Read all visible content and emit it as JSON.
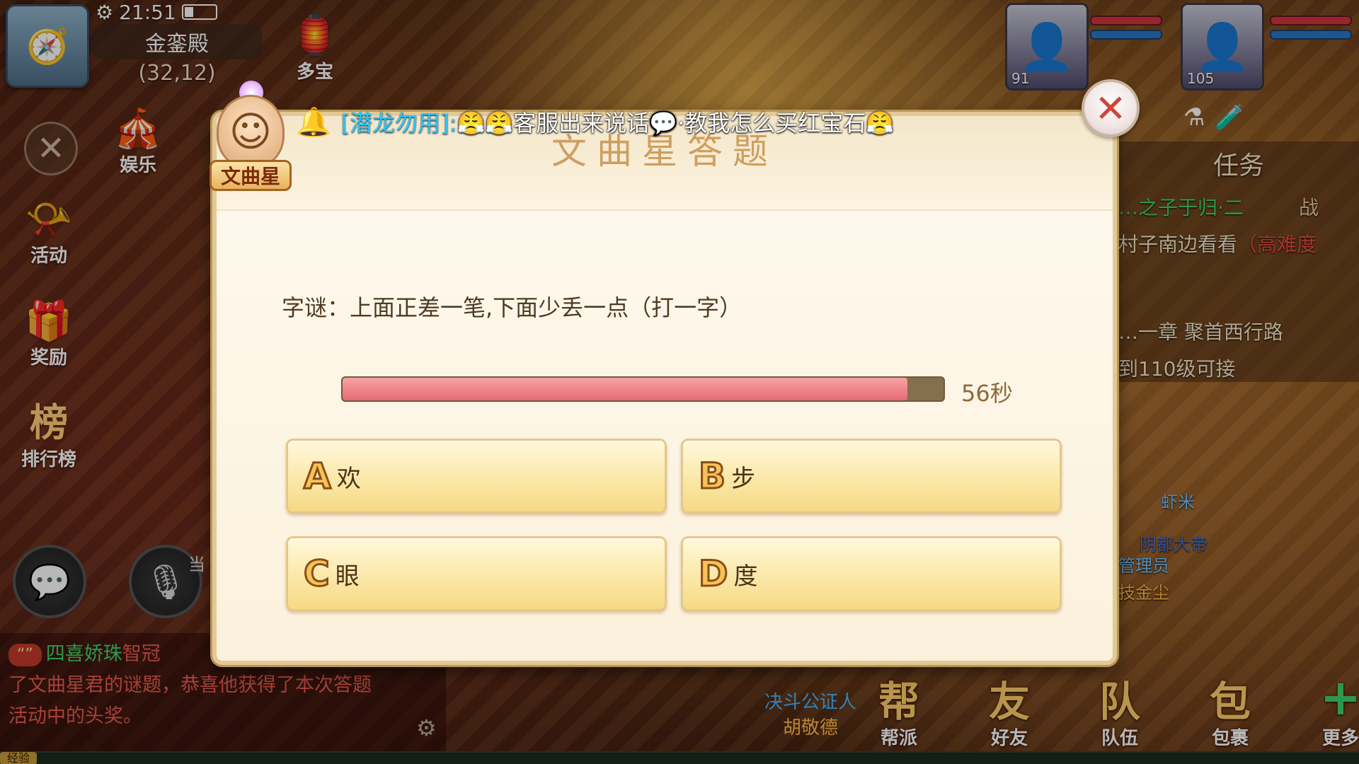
{
  "status": {
    "time": "21:51"
  },
  "location": {
    "name": "金銮殿",
    "coords": "(32,12)"
  },
  "left_menu": [
    {
      "label": "多宝",
      "icon": "treasure-icon"
    },
    {
      "label": "娱乐",
      "icon": "entertainment-icon"
    },
    {
      "label": "活动",
      "icon": "event-horn-icon"
    },
    {
      "label": "奖励",
      "icon": "gift-icon"
    },
    {
      "label": "排行榜",
      "icon": "ranking-icon",
      "glyph": "榜"
    }
  ],
  "voice": {
    "tag": "当"
  },
  "chat": {
    "badge": "“”",
    "name": "四喜娇珠",
    "who": "智冠",
    "line2": "了文曲星君的谜题，恭喜他获得了本次答题",
    "line3": "活动中的头奖。"
  },
  "exp_label": "经验",
  "party": [
    {
      "level": "91",
      "icon": "white-hair-hero-portrait"
    },
    {
      "level": "105",
      "icon": "dark-hair-hero-portrait"
    }
  ],
  "tasks": {
    "title": "任务",
    "lines": [
      {
        "text": "…之子于归·二",
        "color": "#3fd26a"
      },
      {
        "text": "村子南边看看",
        "extra": "（高难度",
        "color": "#f5e6c8",
        "extra_color": "#e84b3c"
      },
      {
        "text": "…一章 聚首西行路",
        "color": "#f5e6c8"
      },
      {
        "text": "到110级可接",
        "color": "#f5e6c8"
      }
    ],
    "battle": "战",
    "nearby_names": [
      "虾米",
      "阴都大帝",
      "管理员",
      "技金尘"
    ]
  },
  "bottom_nav": [
    {
      "label": "帮派",
      "glyph": "帮",
      "icon": "guild-icon"
    },
    {
      "label": "好友",
      "glyph": "友",
      "icon": "friends-icon"
    },
    {
      "label": "队伍",
      "glyph": "队",
      "icon": "team-icon"
    },
    {
      "label": "包裹",
      "glyph": "包",
      "icon": "bag-icon"
    },
    {
      "label": "更多",
      "glyph": "+",
      "icon": "more-plus-icon"
    }
  ],
  "duel": {
    "line1": "决斗公证人",
    "line2": "胡敬德"
  },
  "broadcast": {
    "speaker": "[潜龙勿用]:",
    "message": "😤😤客服出来说话💬·教我怎么买红宝石😤"
  },
  "dialog": {
    "title": "文曲星答题",
    "npc_name": "文曲星",
    "question": "字谜：上面正差一笔,下面少丢一点（打一字）",
    "timer_text": "56秒",
    "timer_fraction": 0.94,
    "answers": [
      {
        "letter": "A",
        "text": "欢"
      },
      {
        "letter": "B",
        "text": "步"
      },
      {
        "letter": "C",
        "text": "眼"
      },
      {
        "letter": "D",
        "text": "度"
      }
    ]
  },
  "colors": {
    "dialog_bg": "#fbf1dc",
    "timer_fill": "#e66b73",
    "close_x": "#d1443a",
    "broadcast_speaker": "#29c8ff"
  }
}
